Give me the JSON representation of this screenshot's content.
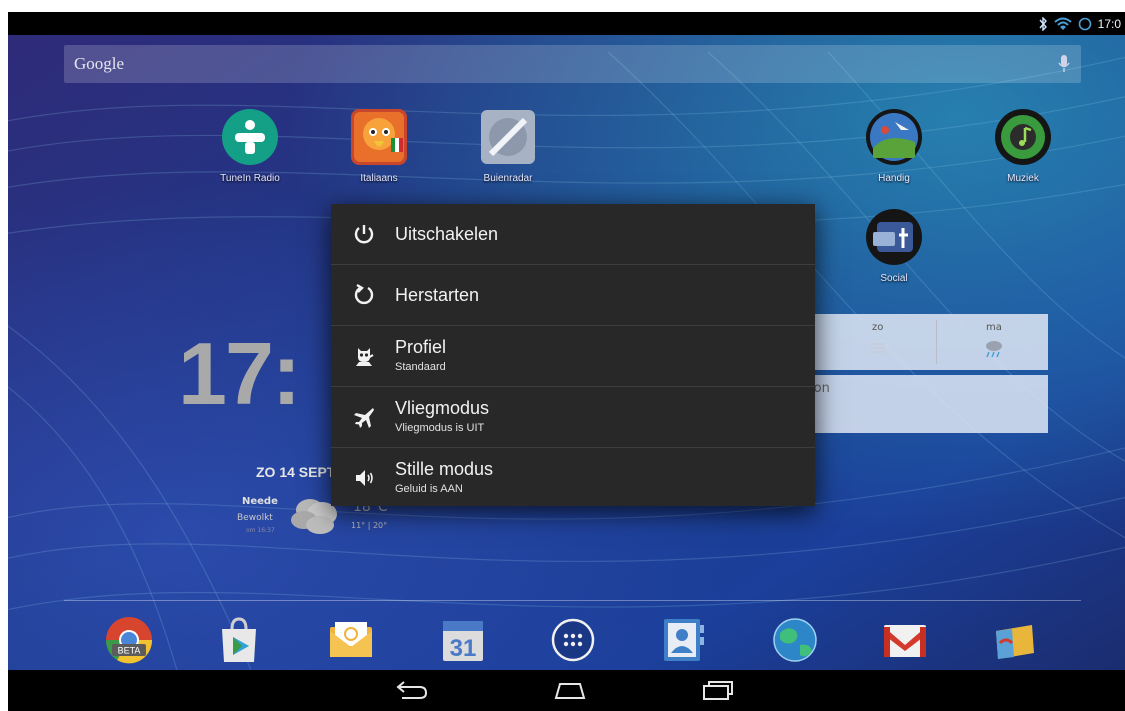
{
  "status_bar": {
    "time": "17:0"
  },
  "search": {
    "label": "Google"
  },
  "home_apps": [
    {
      "label": "TuneIn Radio"
    },
    {
      "label": "Italiaans"
    },
    {
      "label": "Buienradar"
    },
    {
      "label": "Handig"
    },
    {
      "label": "Muziek"
    },
    {
      "label": "Social"
    }
  ],
  "clock_widget": {
    "time": "17:",
    "date": "ZO 14 SEPT"
  },
  "weather": {
    "city": "Neede",
    "condition": "Bewolkt",
    "updated": "om 16:37",
    "temp": "18°C",
    "range": "11° | 20°"
  },
  "forecast": {
    "days": [
      "zo",
      "ma"
    ],
    "info_fragment": "ion"
  },
  "power_menu": {
    "items": [
      {
        "title": "Uitschakelen",
        "subtitle": "",
        "icon": "power-icon"
      },
      {
        "title": "Herstarten",
        "subtitle": "",
        "icon": "restart-icon"
      },
      {
        "title": "Profiel",
        "subtitle": "Standaard",
        "icon": "profile-icon"
      },
      {
        "title": "Vliegmodus",
        "subtitle": "Vliegmodus is UIT",
        "icon": "airplane-icon"
      },
      {
        "title": "Stille modus",
        "subtitle": "Geluid is AAN",
        "icon": "speaker-icon"
      }
    ]
  },
  "dock": {
    "apps": [
      "chrome-beta-icon",
      "play-store-icon",
      "email-icon",
      "calendar-icon",
      "app-drawer-icon",
      "contacts-icon",
      "browser-globe-icon",
      "gmail-icon",
      "wallet-icon"
    ],
    "chrome_badge": "BETA",
    "calendar_day": "31"
  },
  "colors": {
    "accent": "#4a9fd8",
    "menu_bg": "#282828"
  }
}
